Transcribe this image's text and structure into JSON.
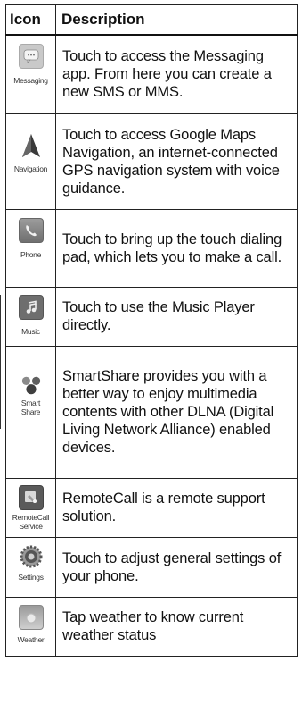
{
  "table": {
    "header_icon": "Icon",
    "header_description": "Description"
  },
  "rows": [
    {
      "icon": "messaging-icon",
      "caption": "Messaging",
      "caption2": "",
      "description": "Touch to access the Messaging app. From here you can create a new SMS or MMS."
    },
    {
      "icon": "navigation-icon",
      "caption": "Navigation",
      "caption2": "",
      "description": "Touch to access Google Maps Navigation, an internet-connected GPS navigation system with voice guidance."
    },
    {
      "icon": "phone-icon",
      "caption": "Phone",
      "caption2": "",
      "description": "Touch to bring up the touch dialing pad, which lets you to make a call."
    },
    {
      "icon": "music-icon",
      "caption": "Music",
      "caption2": "",
      "description": "Touch to use the Music Player directly."
    },
    {
      "icon": "smartshare-icon",
      "caption": "Smart",
      "caption2": "Share",
      "description": "SmartShare provides you with a better way to enjoy multimedia contents with other DLNA (Digital Living Network Alliance) enabled devices."
    },
    {
      "icon": "remotecall-icon",
      "caption": "RemoteCall",
      "caption2": "Service",
      "description": "RemoteCall  is a remote support solution."
    },
    {
      "icon": "settings-icon",
      "caption": "Settings",
      "caption2": "",
      "description": "Touch to adjust general settings of your phone."
    },
    {
      "icon": "weather-icon",
      "caption": "Weather",
      "caption2": "",
      "description": "Tap weather to know current weather status"
    }
  ]
}
